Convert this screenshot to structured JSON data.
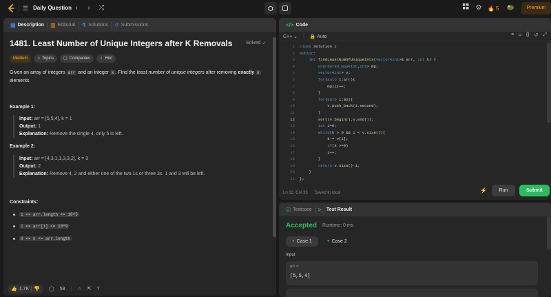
{
  "topbar": {
    "title": "Daily Question",
    "prev_icon": "chevron-left-icon",
    "next_icon": "chevron-right-icon",
    "shuffle_icon": "shuffle-icon",
    "streak_count": "5",
    "premium_label": "Premium",
    "accent": "#ffa116"
  },
  "desc_tabs": [
    {
      "label": "Description",
      "icon": "document-icon"
    },
    {
      "label": "Editorial",
      "icon": "book-icon"
    },
    {
      "label": "Solutions",
      "icon": "flask-icon"
    },
    {
      "label": "Submissions",
      "icon": "history-icon"
    }
  ],
  "problem": {
    "title": "1481. Least Number of Unique Integers after K Removals",
    "solved": "Solved",
    "difficulty": "Medium",
    "topics": "Topics",
    "companies": "Companies",
    "hint": "Hint",
    "desc_1": "Given an array of integers ",
    "desc_arr": "arr",
    "desc_2": " and an integer ",
    "desc_k": "k",
    "desc_3": ". Find the ",
    "desc_em": "least number of unique integers",
    "desc_4": " after removing ",
    "desc_b": "exactly",
    "desc_k2": "k",
    "desc_5": "elements."
  },
  "examples": [
    {
      "heading": "Example 1:",
      "input_label": "Input:",
      "input": "arr = [5,5,4], k = 1",
      "output_label": "Output:",
      "output": "1",
      "explanation_label": "Explanation:",
      "explanation": "Remove the single 4, only 5 is left."
    },
    {
      "heading": "Example 2:",
      "input_label": "Input:",
      "input": "arr = [4,3,1,1,3,3,2], k = 3",
      "output_label": "Output:",
      "output": "2",
      "explanation_label": "Explanation:",
      "explanation": "Remove 4, 2 and either one of the two 1s or three 3s. 1 and 3 will be left."
    }
  ],
  "constraints": {
    "heading": "Constraints:",
    "items": [
      "1 <= arr.length <= 10^5",
      "1 <= arr[i] <= 10^9",
      "0 <= k <= arr.length"
    ]
  },
  "desc_footer": {
    "likes": "1.7K",
    "comments": "58"
  },
  "code_panel": {
    "title": "Code",
    "language": "C++",
    "mode": "Auto",
    "status": "Ln 12, Col 33",
    "saved": "Saved to local",
    "run": "Run",
    "submit": "Submit",
    "current_line": 12,
    "lines": [
      {
        "n": "1",
        "code": "class Solution {"
      },
      {
        "n": "2",
        "code": "public:"
      },
      {
        "n": "3",
        "code": "    int findLeastNumOfUniqueInts(vector<int>& arr, int k) {"
      },
      {
        "n": "4",
        "code": "        unordered_map<int,int> mp;"
      },
      {
        "n": "5",
        "code": "        vector<int> v;"
      },
      {
        "n": "6",
        "code": "        for(auto i:arr){"
      },
      {
        "n": "7",
        "code": "            mp[i]++;"
      },
      {
        "n": "8",
        "code": "        }"
      },
      {
        "n": "9",
        "code": "        for(auto i:mp){"
      },
      {
        "n": "10",
        "code": "            v.push_back(i.second);"
      },
      {
        "n": "11",
        "code": "        }"
      },
      {
        "n": "12",
        "code": "        sort(v.begin(),v.end());"
      },
      {
        "n": "13",
        "code": "        int i=0;"
      },
      {
        "n": "14",
        "code": "        while(k > 0 && i < v.size()){"
      },
      {
        "n": "15",
        "code": "            k-= v[i];"
      },
      {
        "n": "16",
        "code": "            if(k >=0)"
      },
      {
        "n": "17",
        "code": "            i++;"
      },
      {
        "n": "18",
        "code": "        }"
      },
      {
        "n": "19",
        "code": "        return v.size()-i;"
      },
      {
        "n": "20",
        "code": "    }"
      },
      {
        "n": "21",
        "code": "};"
      }
    ]
  },
  "test_panel": {
    "tab_testcase": "Testcase",
    "tab_result": "Test Result",
    "verdict": "Accepted",
    "runtime": "Runtime: 0 ms",
    "case1": "Case 1",
    "case2": "Case 2",
    "input_label": "Input",
    "var_name": "arr =",
    "var_value": "[5,5,4]",
    "success_color": "#2cbb5d"
  }
}
